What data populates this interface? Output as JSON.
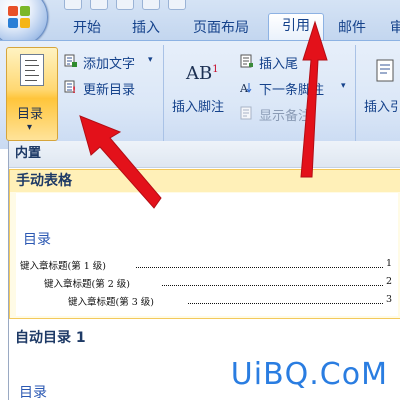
{
  "tabs": [
    {
      "label": "开始"
    },
    {
      "label": "插入"
    },
    {
      "label": "页面布局"
    },
    {
      "label": "引用"
    },
    {
      "label": "邮件"
    },
    {
      "label": "审"
    }
  ],
  "active_tab": "引用",
  "ribbon": {
    "toc_button_label": "目录",
    "toc_dropdown_arrow": "▾",
    "add_text_label": "添加文字",
    "add_text_arrow": "▾",
    "update_toc_label": "更新目录",
    "insert_footnote_label": "插入脚注",
    "footnote_icon_text": "AB",
    "footnote_icon_sup": "1",
    "insert_endnote_label": "插入尾",
    "next_footnote_label": "下一条脚注",
    "next_footnote_arrow": "▾",
    "show_notes_label": "显示备注",
    "insert_citation_label": "插入引"
  },
  "gallery": {
    "builtin_header": "内置",
    "manual_table_label": "手动表格",
    "preview_title": "目录",
    "entries": [
      {
        "text": "键入章标题(第 1 级)",
        "page": "1"
      },
      {
        "text": "键入章标题(第 2 级)",
        "page": "2"
      },
      {
        "text": "键入章标题(第 3 级)",
        "page": "3"
      }
    ],
    "auto_toc_label": "自动目录 1",
    "auto_preview_title": "目录"
  },
  "watermark": "UiBQ.CoM",
  "colors": {
    "accent": "#15428b",
    "highlight": "#fff3c5",
    "arrow": "#e3111a",
    "watermark": "#2a7de1"
  }
}
